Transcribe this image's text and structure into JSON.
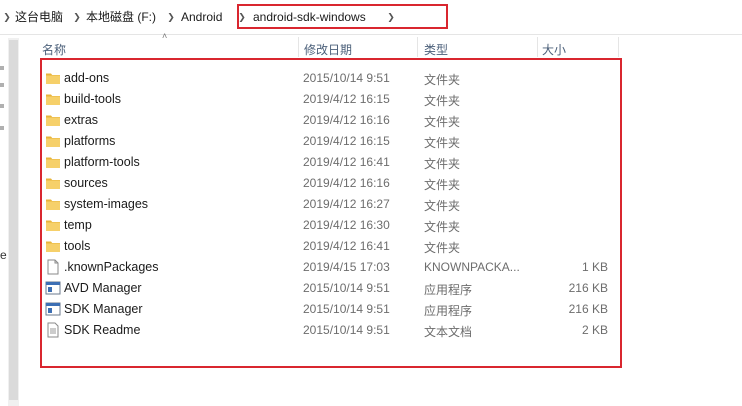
{
  "breadcrumb": {
    "items": [
      "这台电脑",
      "本地磁盘 (F:)",
      "Android",
      "android-sdk-windows"
    ]
  },
  "columns": {
    "name": "名称",
    "date": "修改日期",
    "type": "类型",
    "size": "大小"
  },
  "nav": {
    "partial_label": "e"
  },
  "files": [
    {
      "name": "add-ons",
      "date": "2015/10/14 9:51",
      "type": "文件夹",
      "size": "",
      "icon": "folder-icon"
    },
    {
      "name": "build-tools",
      "date": "2019/4/12 16:15",
      "type": "文件夹",
      "size": "",
      "icon": "folder-icon"
    },
    {
      "name": "extras",
      "date": "2019/4/12 16:16",
      "type": "文件夹",
      "size": "",
      "icon": "folder-icon"
    },
    {
      "name": "platforms",
      "date": "2019/4/12 16:15",
      "type": "文件夹",
      "size": "",
      "icon": "folder-icon"
    },
    {
      "name": "platform-tools",
      "date": "2019/4/12 16:41",
      "type": "文件夹",
      "size": "",
      "icon": "folder-icon"
    },
    {
      "name": "sources",
      "date": "2019/4/12 16:16",
      "type": "文件夹",
      "size": "",
      "icon": "folder-icon"
    },
    {
      "name": "system-images",
      "date": "2019/4/12 16:27",
      "type": "文件夹",
      "size": "",
      "icon": "folder-icon"
    },
    {
      "name": "temp",
      "date": "2019/4/12 16:30",
      "type": "文件夹",
      "size": "",
      "icon": "folder-icon"
    },
    {
      "name": "tools",
      "date": "2019/4/12 16:41",
      "type": "文件夹",
      "size": "",
      "icon": "folder-icon"
    },
    {
      "name": ".knownPackages",
      "date": "2019/4/15 17:03",
      "type": "KNOWNPACKA...",
      "size": "1 KB",
      "icon": "file-icon"
    },
    {
      "name": "AVD Manager",
      "date": "2015/10/14 9:51",
      "type": "应用程序",
      "size": "216 KB",
      "icon": "app-icon"
    },
    {
      "name": "SDK Manager",
      "date": "2015/10/14 9:51",
      "type": "应用程序",
      "size": "216 KB",
      "icon": "app-icon"
    },
    {
      "name": "SDK Readme",
      "date": "2015/10/14 9:51",
      "type": "文本文档",
      "size": "2 KB",
      "icon": "text-file-icon"
    }
  ],
  "colors": {
    "highlight": "#d9262f",
    "folder": "#f3c440",
    "header_text": "#4c607a"
  }
}
